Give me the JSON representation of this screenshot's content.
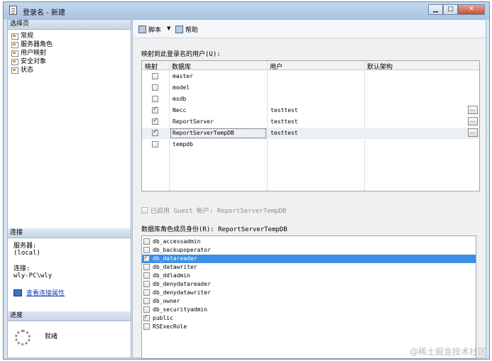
{
  "window": {
    "title": "登录名 - 新建",
    "buttons": {
      "minimize": "▁",
      "maximize": "□",
      "close": "✕"
    }
  },
  "left_panel": {
    "select_page_header": "选择页",
    "pages": [
      {
        "label": "常规",
        "icon": "page-icon"
      },
      {
        "label": "服务器角色",
        "icon": "page-icon"
      },
      {
        "label": "用户映射",
        "icon": "page-icon"
      },
      {
        "label": "安全对象",
        "icon": "page-icon"
      },
      {
        "label": "状态",
        "icon": "page-icon"
      }
    ],
    "connection_header": "连接",
    "server_label": "服务器:",
    "server_value": "(local)",
    "connection_label": "连接:",
    "connection_value": "wly-PC\\wly",
    "view_props_link": "查看连接属性",
    "progress_header": "进度",
    "progress_status": "就绪"
  },
  "toolbar": {
    "script_label": "脚本",
    "dropdown_arrow": "▼",
    "help_label": "帮助"
  },
  "mapping": {
    "label": "映射到此登录名的用户(U):",
    "columns": [
      "映射",
      "数据库",
      "用户",
      "默认架构"
    ],
    "rows": [
      {
        "mapped": false,
        "database": "master",
        "user": "",
        "schema": ""
      },
      {
        "mapped": false,
        "database": "model",
        "user": "",
        "schema": ""
      },
      {
        "mapped": false,
        "database": "msdb",
        "user": "",
        "schema": ""
      },
      {
        "mapped": true,
        "database": "Necc",
        "user": "testtest",
        "schema": "",
        "button": "..."
      },
      {
        "mapped": true,
        "database": "ReportServer",
        "user": "testtest",
        "schema": "",
        "button": "..."
      },
      {
        "mapped": true,
        "database": "ReportServerTempDB",
        "user": "testtest",
        "schema": "",
        "button": "..."
      },
      {
        "mapped": false,
        "database": "tempdb",
        "user": "",
        "schema": ""
      }
    ]
  },
  "guest": {
    "label": "已启用 Guest 帐户: ReportServerTempDB",
    "checked": false
  },
  "roles": {
    "label": "数据库角色成员身份(R): ReportServerTempDB",
    "items": [
      {
        "name": "db_accessadmin",
        "checked": false
      },
      {
        "name": "db_backupoperator",
        "checked": false
      },
      {
        "name": "db_datareader",
        "checked": true,
        "selected": true
      },
      {
        "name": "db_datawriter",
        "checked": false
      },
      {
        "name": "db_ddladmin",
        "checked": false
      },
      {
        "name": "db_denydatareader",
        "checked": false
      },
      {
        "name": "db_denydatawriter",
        "checked": false
      },
      {
        "name": "db_owner",
        "checked": false
      },
      {
        "name": "db_securityadmin",
        "checked": false
      },
      {
        "name": "public",
        "checked": true
      },
      {
        "name": "RSExecRole",
        "checked": false
      }
    ]
  },
  "watermark": "@稀土掘金技术社区",
  "colors": {
    "selection": "#3b8fe6",
    "header_bg": "#d6e3f1",
    "link": "#1a3fb0"
  }
}
